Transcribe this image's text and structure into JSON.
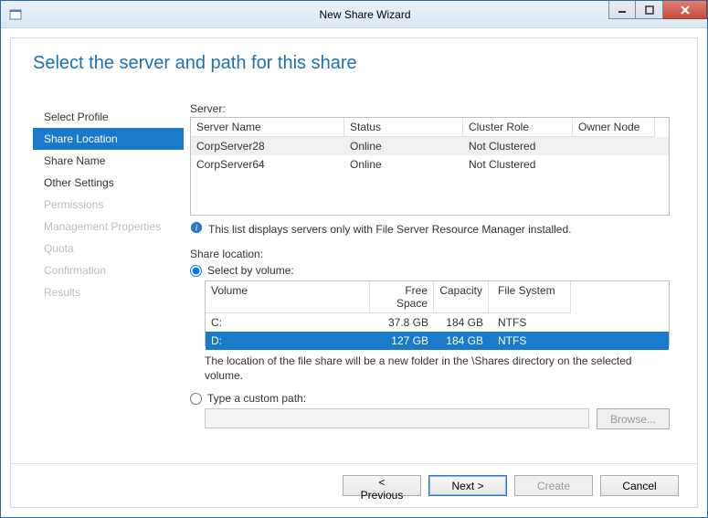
{
  "window": {
    "title": "New Share Wizard"
  },
  "page": {
    "heading": "Select the server and path for this share"
  },
  "steps": [
    {
      "label": "Select Profile",
      "state": "visited"
    },
    {
      "label": "Share Location",
      "state": "current"
    },
    {
      "label": "Share Name",
      "state": "visited"
    },
    {
      "label": "Other Settings",
      "state": "visited"
    },
    {
      "label": "Permissions",
      "state": "disabled"
    },
    {
      "label": "Management Properties",
      "state": "disabled"
    },
    {
      "label": "Quota",
      "state": "disabled"
    },
    {
      "label": "Confirmation",
      "state": "disabled"
    },
    {
      "label": "Results",
      "state": "disabled"
    }
  ],
  "server": {
    "label": "Server:",
    "columns": [
      "Server Name",
      "Status",
      "Cluster Role",
      "Owner Node"
    ],
    "rows": [
      {
        "name": "CorpServer28",
        "status": "Online",
        "cluster": "Not Clustered",
        "owner": "",
        "selected": true
      },
      {
        "name": "CorpServer64",
        "status": "Online",
        "cluster": "Not Clustered",
        "owner": "",
        "selected": false
      }
    ],
    "info": "This list displays servers only with File Server Resource Manager installed."
  },
  "share_location": {
    "label": "Share location:",
    "by_volume": {
      "radio_label": "Select by volume:",
      "checked": true,
      "columns": [
        "Volume",
        "Free Space",
        "Capacity",
        "File System"
      ],
      "rows": [
        {
          "volume": "C:",
          "free": "37.8 GB",
          "capacity": "184 GB",
          "fs": "NTFS",
          "selected": false
        },
        {
          "volume": "D:",
          "free": "127 GB",
          "capacity": "184 GB",
          "fs": "NTFS",
          "selected": true
        }
      ],
      "note": "The location of the file share will be a new folder in the \\Shares directory on the selected volume."
    },
    "custom": {
      "radio_label": "Type a custom path:",
      "checked": false,
      "value": "",
      "browse_label": "Browse..."
    }
  },
  "footer": {
    "previous": "< Previous",
    "next": "Next >",
    "create": "Create",
    "cancel": "Cancel"
  }
}
